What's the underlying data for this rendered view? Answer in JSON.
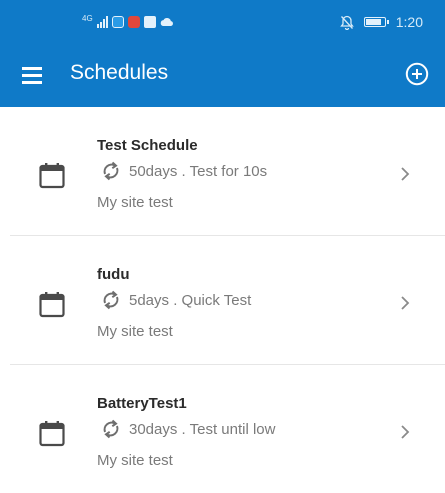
{
  "status_bar": {
    "network_label": "4G",
    "time": "1:20",
    "app_icon_colors": [
      "#2a9be6",
      "#e2473b",
      "#e3f1fb"
    ]
  },
  "app_bar": {
    "title": "Schedules",
    "background_color": "#0f7ac8"
  },
  "schedules": [
    {
      "name": "Test Schedule",
      "frequency": "50days . Test for 10s",
      "site": "My site test"
    },
    {
      "name": "fudu",
      "frequency": "5days . Quick Test",
      "site": "My site test"
    },
    {
      "name": "BatteryTest1",
      "frequency": "30days . Test until low",
      "site": "My site test"
    }
  ],
  "icons": {
    "menu": "hamburger-menu-icon",
    "add": "add-circle-icon",
    "calendar": "calendar-icon",
    "repeat": "repeat-icon",
    "chevron": "chevron-right-icon"
  }
}
